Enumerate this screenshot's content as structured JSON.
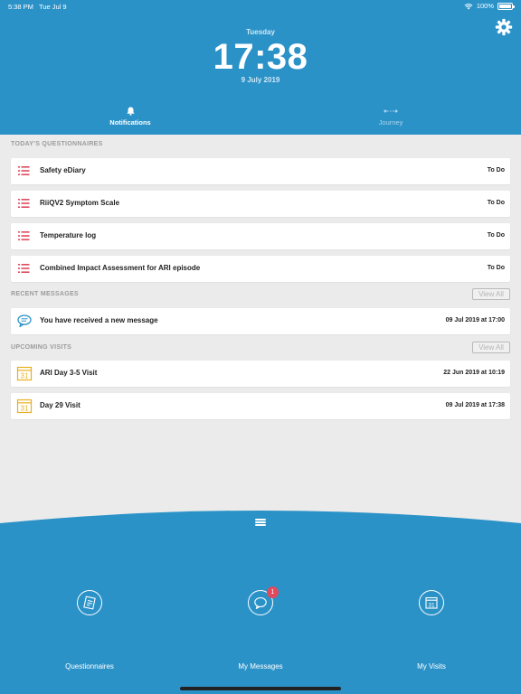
{
  "status_bar": {
    "time": "5:38 PM",
    "date": "Tue Jul 9",
    "battery": "100%"
  },
  "header": {
    "day": "Tuesday",
    "clock": "17:38",
    "date": "9 July 2019"
  },
  "tabs": [
    {
      "label": "Notifications",
      "icon": "bell-icon",
      "active": true
    },
    {
      "label": "Journey",
      "icon": "journey-icon",
      "active": false
    }
  ],
  "questionnaires": {
    "title": "TODAY'S QUESTIONNAIRES",
    "items": [
      {
        "label": "Safety eDiary",
        "status": "To Do"
      },
      {
        "label": "RiiQV2 Symptom Scale",
        "status": "To Do"
      },
      {
        "label": "Temperature log",
        "status": "To Do"
      },
      {
        "label": "Combined Impact Assessment for ARI episode",
        "status": "To Do"
      }
    ]
  },
  "messages": {
    "title": "RECENT MESSAGES",
    "view_all": "View All",
    "items": [
      {
        "label": "You have received a new message",
        "time": "09 Jul 2019 at 17:00"
      }
    ]
  },
  "visits": {
    "title": "UPCOMING VISITS",
    "view_all": "View All",
    "items": [
      {
        "label": "ARI Day 3-5 Visit",
        "time": "22 Jun 2019 at 10:19"
      },
      {
        "label": "Day 29 Visit",
        "time": "09 Jul 2019 at 17:38"
      }
    ]
  },
  "bottom_nav": [
    {
      "label": "Questionnaires",
      "icon": "questionnaire-icon"
    },
    {
      "label": "My Messages",
      "icon": "messages-icon",
      "badge": "1"
    },
    {
      "label": "My Visits",
      "icon": "calendar-icon"
    }
  ],
  "colors": {
    "primary": "#2b92c8",
    "list_icon": "#e04a5f",
    "calendar_icon": "#e8b020",
    "message_icon": "#2b92c8",
    "badge": "#e04a5f",
    "background": "#ebebeb"
  }
}
